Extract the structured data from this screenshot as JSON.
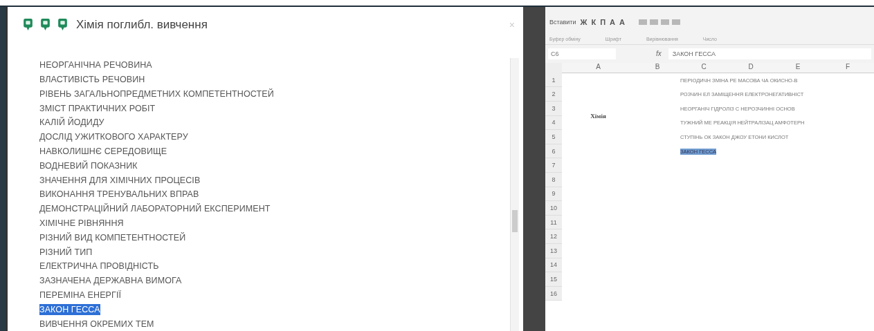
{
  "dialog": {
    "title": "Хімія поглибл. вивчення",
    "close": "×",
    "items": [
      {
        "label": "НЕОРГАНІЧНА РЕЧОВИНА",
        "selected": false
      },
      {
        "label": "ВЛАСТИВІСТЬ РЕЧОВИН",
        "selected": false
      },
      {
        "label": "РІВЕНЬ ЗАГАЛЬНОПРЕДМЕТНИХ КОМПЕТЕНТНОСТЕЙ",
        "selected": false
      },
      {
        "label": "ЗМІСТ ПРАКТИЧНИХ РОБІТ",
        "selected": false
      },
      {
        "label": "КАЛІЙ ЙОДИДУ",
        "selected": false
      },
      {
        "label": "ДОСЛІД УЖИТКОВОГО ХАРАКТЕРУ",
        "selected": false
      },
      {
        "label": "НАВКОЛИШНЄ СЕРЕДОВИЩЕ",
        "selected": false
      },
      {
        "label": "ВОДНЕВИЙ ПОКАЗНИК",
        "selected": false
      },
      {
        "label": "ЗНАЧЕННЯ ДЛЯ ХІМІЧНИХ ПРОЦЕСІВ",
        "selected": false
      },
      {
        "label": "ВИКОНАННЯ ТРЕНУВАЛЬНИХ ВПРАВ",
        "selected": false
      },
      {
        "label": "ДЕМОНСТРАЦІЙНИЙ ЛАБОРАТОРНИЙ ЕКСПЕРИМЕНТ",
        "selected": false
      },
      {
        "label": "ХІМІЧНЕ РІВНЯННЯ",
        "selected": false
      },
      {
        "label": "РІЗНИЙ ВИД КОМПЕТЕНТНОСТЕЙ",
        "selected": false
      },
      {
        "label": "РІЗНИЙ ТИП",
        "selected": false
      },
      {
        "label": "ЕЛЕКТРИЧНА ПРОВІДНІСТЬ",
        "selected": false
      },
      {
        "label": "ЗАЗНАЧЕНА ДЕРЖАВНА ВИМОГА",
        "selected": false
      },
      {
        "label": "ПЕРЕМІНА ЕНЕРГІЇ",
        "selected": false
      },
      {
        "label": "ЗАКОН ГЕССА",
        "selected": true
      },
      {
        "label": "ВИВЧЕННЯ ОКРЕМИХ ТЕМ",
        "selected": false
      }
    ]
  },
  "spreadsheet": {
    "ribbon": {
      "paste": "Вставити",
      "font_buttons": [
        "Ж",
        "К",
        "П",
        "A",
        "A"
      ],
      "groups": [
        "Буфер обміну",
        "Шрифт",
        "Вирівнювання",
        "Число"
      ]
    },
    "name_box": "C6",
    "fx": "fx",
    "formula": "ЗАКОН ГЕССА",
    "columns": [
      "A",
      "B",
      "C",
      "D",
      "E",
      "F"
    ],
    "row_numbers": [
      "1",
      "2",
      "3",
      "4",
      "5",
      "6",
      "7",
      "8",
      "9",
      "10",
      "11",
      "12",
      "13",
      "14",
      "15",
      "16"
    ],
    "subject": "Хімія",
    "rows": [
      {
        "text": "ПЕРІОДИЧН ЗМІНА РЕ МАСОВА ЧА ОКИСНО-В",
        "selected": false
      },
      {
        "text": "РОЗЧИН ЕЛ ЗАМІЩЕННЯ ЕЛЕКТРОНЕГАТИВНІСТ",
        "selected": false
      },
      {
        "text": "НЕОРГАНІЧ ГІДРОЛІЗ С НЕРОЗЧИННІ ОСНОВ",
        "selected": false
      },
      {
        "text": "ТУЖНИЙ МЕ РЕАКЦІЯ НЕЙТРАЛІЗАЦ АМФОТЕРН",
        "selected": false
      },
      {
        "text": "СТУПІНЬ ОК ЗАКОН ДЖОУ ЕТОНИ КИСЛОТ",
        "selected": false
      },
      {
        "text": "ЗАКОН ГЕССА",
        "selected": true
      }
    ]
  }
}
